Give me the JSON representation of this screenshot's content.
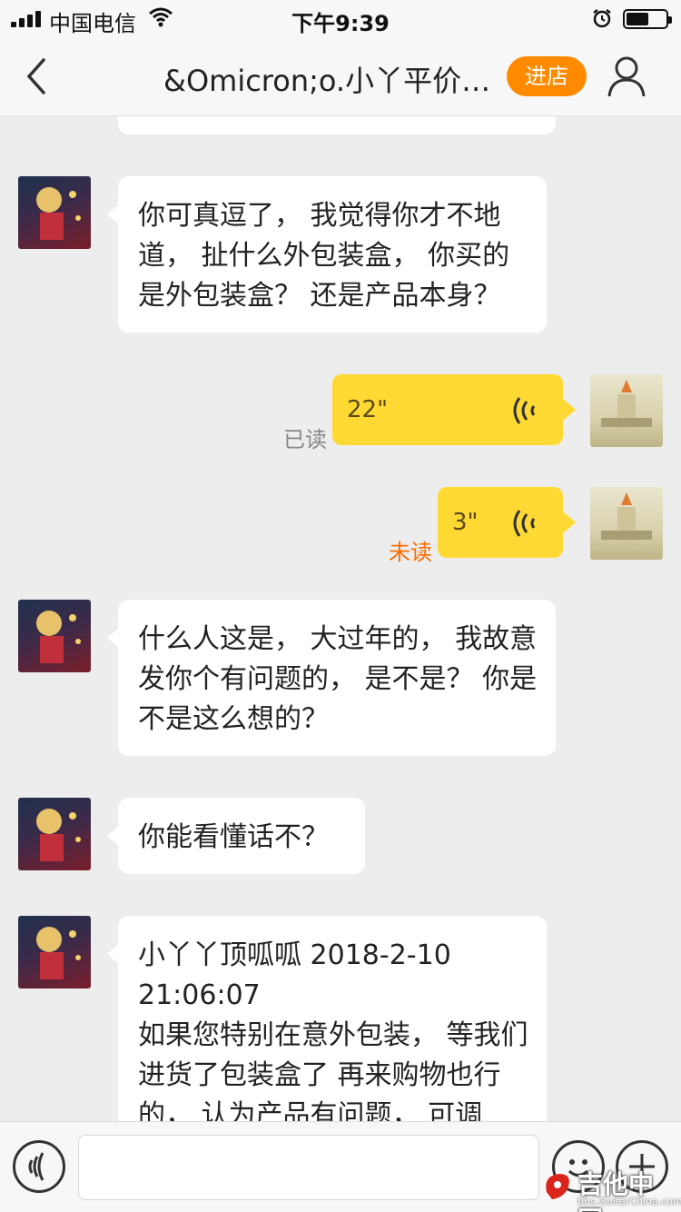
{
  "status_bar": {
    "carrier": "中国电信",
    "time": "下午9:39"
  },
  "nav": {
    "title": "&Omicron;o.小丫平价…",
    "shop_button": "进店"
  },
  "messages": [
    {
      "from": "them",
      "text": "你可真逗了， 我觉得你才不地道， 扯什么外包装盒， 你买的是外包装盒？ 还是产品本身？"
    },
    {
      "from": "me",
      "type": "voice",
      "duration": "22\"",
      "status": "已读"
    },
    {
      "from": "me",
      "type": "voice",
      "duration": "3\"",
      "status": "未读"
    },
    {
      "from": "them",
      "text": "什么人这是， 大过年的， 我故意发你个有问题的， 是不是？ 你是不是这么想的？"
    },
    {
      "from": "them",
      "text": "你能看懂话不？"
    },
    {
      "from": "them",
      "text_lines": [
        "小丫丫顶呱呱 2018-2-10 21:06:07",
        "如果您特别在意外包装， 等我们进货了包装盒了 再来购物也行的， 认为产品有问题， 可调"
      ]
    }
  ],
  "input": {
    "placeholder": ""
  },
  "watermark": {
    "main": "吉他中国",
    "sub": "bbs.GuitarChina.com"
  },
  "colors": {
    "accent": "#ff8a00",
    "voice_bubble": "#ffd933",
    "read": "#888888",
    "unread": "#ff6a00"
  }
}
